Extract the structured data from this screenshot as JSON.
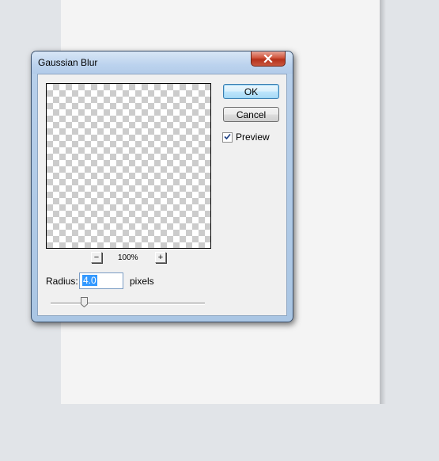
{
  "dialog": {
    "title": "Gaussian Blur",
    "ok_label": "OK",
    "cancel_label": "Cancel",
    "preview_label": "Preview",
    "preview_checked": true,
    "zoom_out_label": "−",
    "zoom_in_label": "+",
    "zoom_level": "100%",
    "radius_label": "Radius:",
    "radius_value": "4.0",
    "radius_units": "pixels",
    "slider_position_fraction": 0.2
  },
  "icons": {
    "close": "close-icon",
    "checkmark": "checkmark-icon"
  },
  "colors": {
    "close_button": "#c9452c",
    "title_bar": "#bcd3ee",
    "selection": "#3399ff"
  }
}
